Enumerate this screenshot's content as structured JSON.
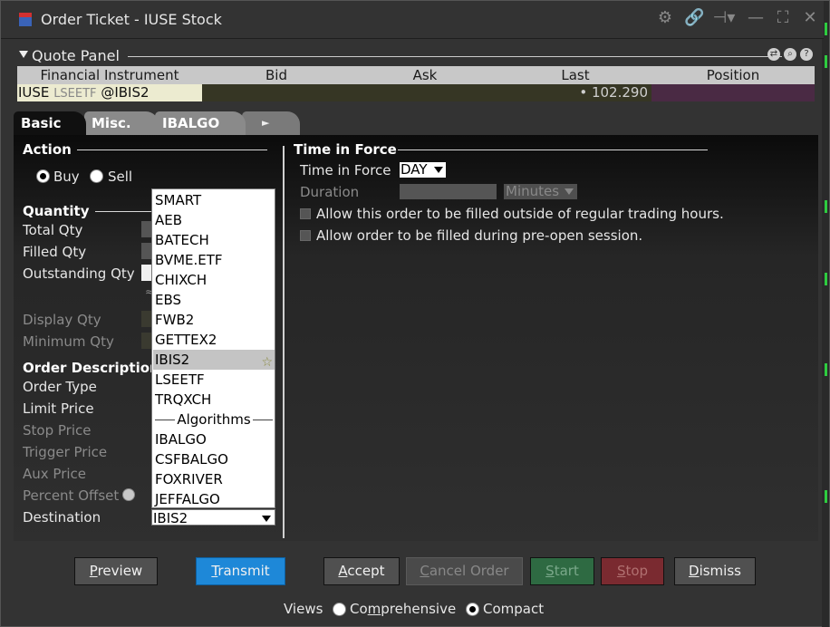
{
  "window": {
    "title": "Order Ticket - IUSE Stock"
  },
  "titlebar_icons": [
    "gear-icon",
    "link-icon",
    "pin-icon",
    "minimize-icon",
    "maximize-icon",
    "close-icon"
  ],
  "quote_panel": {
    "title": "Quote Panel",
    "columns": [
      "Financial Instrument",
      "Bid",
      "Ask",
      "Last",
      "Position"
    ],
    "row": {
      "symbol": "IUSE",
      "exchange_hint": "LSEETF",
      "route": "@IBIS2",
      "last": "• 102.290"
    }
  },
  "tabs": [
    "Basic",
    "Misc.",
    "IBALGO"
  ],
  "action": {
    "heading": "Action",
    "buy": "Buy",
    "sell": "Sell",
    "selected": "Buy"
  },
  "quantity": {
    "heading": "Quantity",
    "total": "Total Qty",
    "filled": "Filled Qty",
    "outstanding": "Outstanding Qty",
    "approx": "≈",
    "display": "Display Qty",
    "minimum": "Minimum Qty"
  },
  "order_description": {
    "heading": "Order Description",
    "order_type": "Order Type",
    "limit_price": "Limit Price",
    "stop_price": "Stop Price",
    "trigger_price": "Trigger Price",
    "aux_price": "Aux Price",
    "percent_offset": "Percent Offset",
    "destination": "Destination",
    "destination_value": "IBIS2"
  },
  "destination_list": {
    "items": [
      "SMART",
      "AEB",
      "BATECH",
      "BVME.ETF",
      "CHIXCH",
      "EBS",
      "FWB2",
      "GETTEX2",
      "IBIS2",
      "LSEETF",
      "TRQXCH"
    ],
    "highlighted": "IBIS2",
    "group_label": "Algorithms",
    "algos": [
      "IBALGO",
      "CSFBALGO",
      "FOXRIVER",
      "JEFFALGO"
    ]
  },
  "time_in_force": {
    "heading": "Time in Force",
    "tif_label": "Time in Force",
    "tif_value": "DAY",
    "duration_label": "Duration",
    "duration_unit": "Minutes",
    "outside_rth": "Allow this order to be filled outside of regular trading hours.",
    "pre_open": "Allow order to be filled during pre-open session."
  },
  "buttons": {
    "preview": {
      "first": "P",
      "rest": "review"
    },
    "transmit": {
      "first": "T",
      "rest": "ransmit"
    },
    "accept": {
      "first": "A",
      "rest": "ccept"
    },
    "cancel": {
      "first": "C",
      "rest": "ancel Order"
    },
    "start": {
      "first": "S",
      "rest": "tart"
    },
    "stop": {
      "first": "S",
      "rest": "top"
    },
    "dismiss": {
      "first": "D",
      "rest": "ismiss"
    }
  },
  "views": {
    "label": "Views",
    "comp_first": "Co",
    "comp_u": "m",
    "comp_rest": "prehensive",
    "compact": "Compact",
    "selected": "Compact"
  }
}
